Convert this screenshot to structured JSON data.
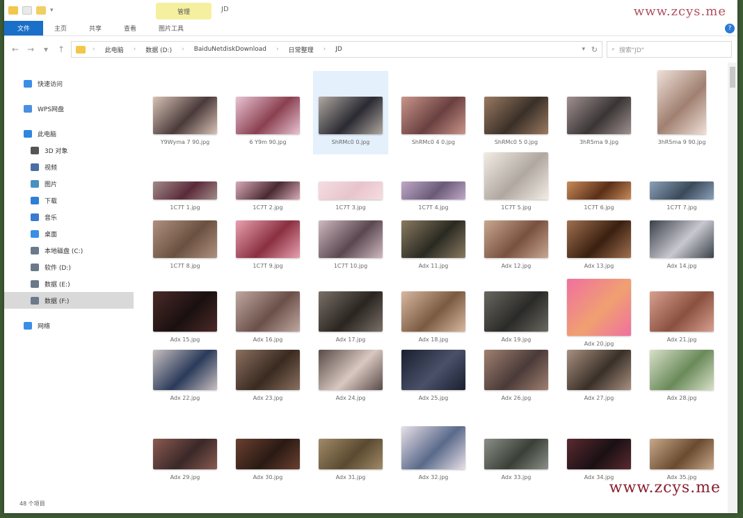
{
  "window": {
    "title_tab": "管理",
    "title_text": "JD"
  },
  "watermarks": {
    "top": "www.zcys.me",
    "bottom": "www.zcys.me"
  },
  "ribbon": {
    "tabs": [
      "文件",
      "主页",
      "共享",
      "查看",
      "图片工具"
    ],
    "help_label": "?"
  },
  "address": {
    "crumbs": [
      "此电脑",
      "数据 (D:)",
      "BaiduNetdiskDownload",
      "日常整理",
      "JD"
    ],
    "search_placeholder": "搜索\"JD\""
  },
  "sidebar": {
    "items": [
      {
        "label": "快速访问",
        "icon": "star-icon",
        "color": "#3a8ee6"
      },
      {
        "label": "WPS网盘",
        "icon": "cloud-icon",
        "color": "#4a8fe0"
      },
      {
        "label": "此电脑",
        "icon": "computer-icon",
        "color": "#2e86de"
      },
      {
        "label": "3D 对象",
        "icon": "cube-icon",
        "color": "#555555"
      },
      {
        "label": "视频",
        "icon": "video-icon",
        "color": "#4a6fa5"
      },
      {
        "label": "图片",
        "icon": "picture-icon",
        "color": "#4a90c0"
      },
      {
        "label": "下载",
        "icon": "download-icon",
        "color": "#2f7fd6"
      },
      {
        "label": "音乐",
        "icon": "music-icon",
        "color": "#3a7ad0"
      },
      {
        "label": "桌面",
        "icon": "desktop-icon",
        "color": "#3a8ee6"
      },
      {
        "label": "本地磁盘 (C:)",
        "icon": "drive-icon",
        "color": "#6a7a8a"
      },
      {
        "label": "软件 (D:)",
        "icon": "drive-icon",
        "color": "#6a7a8a"
      },
      {
        "label": "数据 (E:)",
        "icon": "drive-icon",
        "color": "#6a7a8a"
      },
      {
        "label": "数据 (F:)",
        "icon": "drive-icon",
        "color": "#6a7a8a"
      },
      {
        "label": "网络",
        "icon": "network-icon",
        "color": "#3a8ee6"
      }
    ],
    "status": "48 个项目"
  },
  "files": [
    {
      "name": "Y9Wyma 7 90.jpg",
      "c1": "#d8c2b5",
      "c2": "#4a3a3a",
      "shape": "wide"
    },
    {
      "name": "6 Y9m 90.jpg",
      "c1": "#e8c3d3",
      "c2": "#8a4050",
      "shape": "wide"
    },
    {
      "name": "ShRMc0 0.jpg",
      "c1": "#b0a8a0",
      "c2": "#2a2a32",
      "shape": "wide",
      "selected": true
    },
    {
      "name": "ShRMc0 4 0.jpg",
      "c1": "#c9958a",
      "c2": "#6a4040",
      "shape": "wide"
    },
    {
      "name": "ShRMc0 5 0.jpg",
      "c1": "#9a7a62",
      "c2": "#3a3028",
      "shape": "wide"
    },
    {
      "name": "3hR5ma 9.jpg",
      "c1": "#a09090",
      "c2": "#3a3535",
      "shape": "wide"
    },
    {
      "name": "3hR5ma 9 90.jpg",
      "c1": "#efe0d8",
      "c2": "#a08070",
      "shape": "portrait"
    },
    {
      "name": "1C7T 1.jpg",
      "c1": "#a28a88",
      "c2": "#5a2a3a",
      "shape": "wide"
    },
    {
      "name": "1C7T 2.jpg",
      "c1": "#d8aab8",
      "c2": "#4a2a32",
      "shape": "wide"
    },
    {
      "name": "1C7T 3.jpg",
      "c1": "#f5dde0",
      "c2": "#e8c4cc",
      "shape": "wide"
    },
    {
      "name": "1C7T 4.jpg",
      "c1": "#c0a8c8",
      "c2": "#6a5a78",
      "shape": "wide"
    },
    {
      "name": "1C7T 5.jpg",
      "c1": "#f2ece4",
      "c2": "#b0a8a0",
      "shape": "square"
    },
    {
      "name": "1C7T 6.jpg",
      "c1": "#c98a5a",
      "c2": "#5a3018",
      "shape": "wide"
    },
    {
      "name": "1C7T 7.jpg",
      "c1": "#8aa0b8",
      "c2": "#3a4a5a",
      "shape": "wide"
    },
    {
      "name": "1C7T 8.jpg",
      "c1": "#b09080",
      "c2": "#6a5040",
      "shape": "wide"
    },
    {
      "name": "1C7T 9.jpg",
      "c1": "#e8a0b0",
      "c2": "#8a3040",
      "shape": "wide"
    },
    {
      "name": "1C7T 10.jpg",
      "c1": "#d0b8c0",
      "c2": "#5a4850",
      "shape": "wide"
    },
    {
      "name": "Adx 11.jpg",
      "c1": "#8a7a60",
      "c2": "#2a2a22",
      "shape": "wide"
    },
    {
      "name": "Adx 12.jpg",
      "c1": "#c8a890",
      "c2": "#7a5040",
      "shape": "wide"
    },
    {
      "name": "Adx 13.jpg",
      "c1": "#a07050",
      "c2": "#3a2010",
      "shape": "wide"
    },
    {
      "name": "Adx 14.jpg",
      "c1": "#3a4048",
      "c2": "#c8c8d0",
      "shape": "wide"
    },
    {
      "name": "Adx 15.jpg",
      "c1": "#4a2a28",
      "c2": "#1a1010",
      "shape": "wide"
    },
    {
      "name": "Adx 16.jpg",
      "c1": "#c0a8a0",
      "c2": "#6a5048",
      "shape": "wide"
    },
    {
      "name": "Adx 17.jpg",
      "c1": "#7a7068",
      "c2": "#2a2520",
      "shape": "wide"
    },
    {
      "name": "Adx 18.jpg",
      "c1": "#d8b8a0",
      "c2": "#7a5a40",
      "shape": "wide"
    },
    {
      "name": "Adx 19.jpg",
      "c1": "#6a6860",
      "c2": "#2a2a28",
      "shape": "wide"
    },
    {
      "name": "Adx 20.jpg",
      "c1": "#f070a0",
      "c2": "#f0a070",
      "shape": "square"
    },
    {
      "name": "Adx 21.jpg",
      "c1": "#d8a090",
      "c2": "#8a5040",
      "shape": "wide"
    },
    {
      "name": "Adx 22.jpg",
      "c1": "#c8c0c0",
      "c2": "#2a3a5a",
      "shape": "wide"
    },
    {
      "name": "Adx 23.jpg",
      "c1": "#8a7060",
      "c2": "#3a2a20",
      "shape": "wide"
    },
    {
      "name": "Adx 24.jpg",
      "c1": "#5a4a48",
      "c2": "#d8c8c0",
      "shape": "wide"
    },
    {
      "name": "Adx 25.jpg",
      "c1": "#1a2030",
      "c2": "#4a5068",
      "shape": "wide"
    },
    {
      "name": "Adx 26.jpg",
      "c1": "#a08070",
      "c2": "#4a3a38",
      "shape": "wide"
    },
    {
      "name": "Adx 27.jpg",
      "c1": "#a89080",
      "c2": "#3a3028",
      "shape": "wide"
    },
    {
      "name": "Adx 28.jpg",
      "c1": "#d8e0c8",
      "c2": "#6a8a5a",
      "shape": "wide"
    },
    {
      "name": "Adx 29.jpg",
      "c1": "#8a5a50",
      "c2": "#3a2828",
      "shape": "wide"
    },
    {
      "name": "Adx 30.jpg",
      "c1": "#6a4030",
      "c2": "#2a1a14",
      "shape": "wide"
    },
    {
      "name": "Adx 31.jpg",
      "c1": "#a08a68",
      "c2": "#5a4a30",
      "shape": "wide"
    },
    {
      "name": "Adx 32.jpg",
      "c1": "#e8e0e8",
      "c2": "#5a6a8a",
      "shape": "square"
    },
    {
      "name": "Adx 33.jpg",
      "c1": "#8a9088",
      "c2": "#3a4038",
      "shape": "wide"
    },
    {
      "name": "Adx 34.jpg",
      "c1": "#5a2a30",
      "c2": "#1a1014",
      "shape": "wide"
    },
    {
      "name": "Adx 35.jpg",
      "c1": "#c8a888",
      "c2": "#6a4a30",
      "shape": "wide"
    }
  ]
}
